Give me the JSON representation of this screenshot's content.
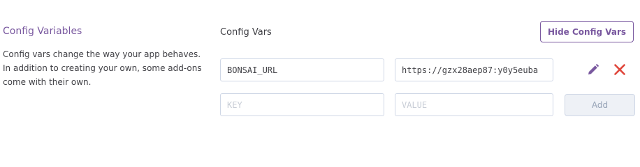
{
  "section": {
    "title": "Config Variables",
    "description": "Config vars change the way your app behaves. In addition to creating your own, some add-ons come with their own."
  },
  "config_vars": {
    "title": "Config Vars",
    "hide_button_label": "Hide Config Vars",
    "rows": [
      {
        "key": "BONSAI_URL",
        "value": "https://gzx28aep87:y0y5euba"
      }
    ],
    "new_row": {
      "key_placeholder": "KEY",
      "value_placeholder": "VALUE",
      "add_button_label": "Add"
    }
  },
  "icons": {
    "edit": "pencil-icon",
    "delete": "close-icon"
  },
  "colors": {
    "accent_purple": "#79589f",
    "delete_red": "#e0473c",
    "text": "#3f3f44",
    "border": "#cfd7e6",
    "disabled_bg": "#eef1f6"
  }
}
